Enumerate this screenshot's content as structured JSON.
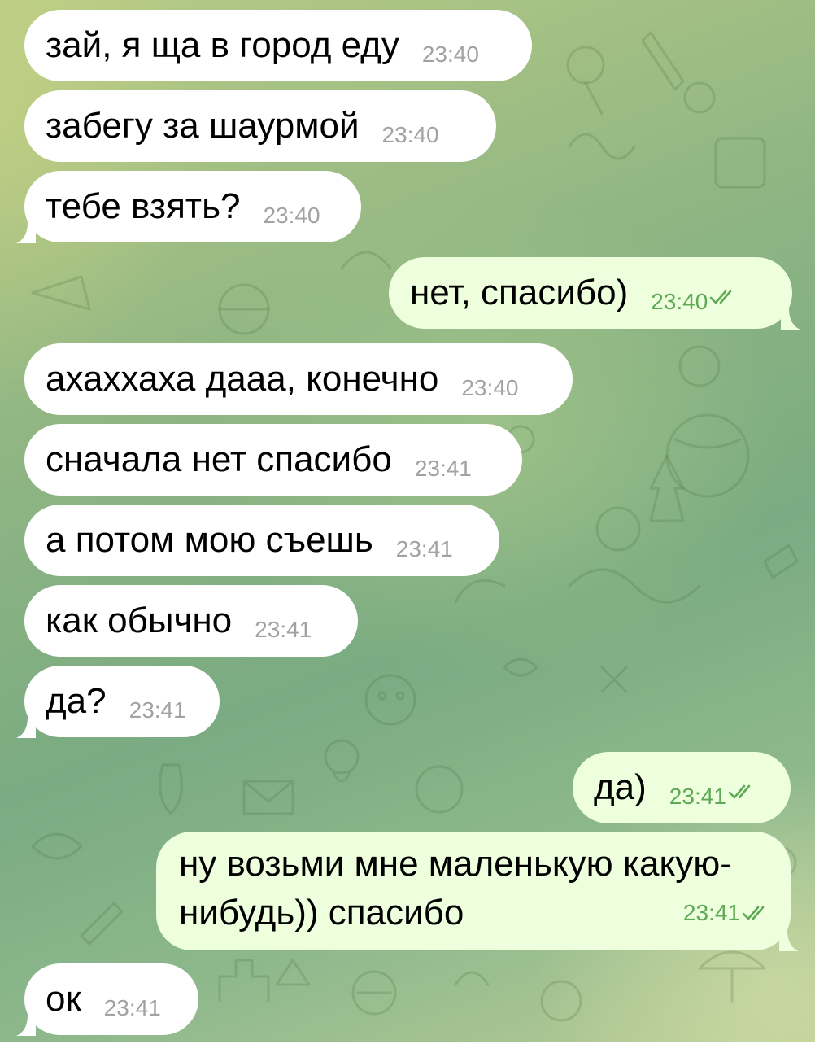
{
  "chat": {
    "messages": [
      {
        "side": "in",
        "text": "зай, я ща в город еду",
        "time": "23:40"
      },
      {
        "side": "in",
        "text": "забегу за шаурмой",
        "time": "23:40"
      },
      {
        "side": "in",
        "text": "тебе взять?",
        "time": "23:40"
      },
      {
        "side": "out",
        "text": "нет, спасибо)",
        "time": "23:40",
        "status": "read"
      },
      {
        "side": "in",
        "text": "ахаххаха дааа, конечно",
        "time": "23:40"
      },
      {
        "side": "in",
        "text": "сначала нет спасибо",
        "time": "23:41"
      },
      {
        "side": "in",
        "text": "а потом мою съешь",
        "time": "23:41"
      },
      {
        "side": "in",
        "text": "как обычно",
        "time": "23:41"
      },
      {
        "side": "in",
        "text": "да?",
        "time": "23:41"
      },
      {
        "side": "out",
        "text": "да)",
        "time": "23:41",
        "status": "read"
      },
      {
        "side": "out",
        "text": "ну возьми мне маленькую какую-нибудь)) спасибо",
        "time": "23:41",
        "status": "read"
      },
      {
        "side": "in",
        "text": "ок",
        "time": "23:41"
      }
    ]
  },
  "colors": {
    "incoming_bubble": "#ffffff",
    "outgoing_bubble": "#eeffde",
    "outgoing_meta": "#5fa855",
    "incoming_meta": "#a2a2a2",
    "wallpaper": "#8fb583"
  },
  "icons": {
    "read_status": "double-check-icon"
  }
}
